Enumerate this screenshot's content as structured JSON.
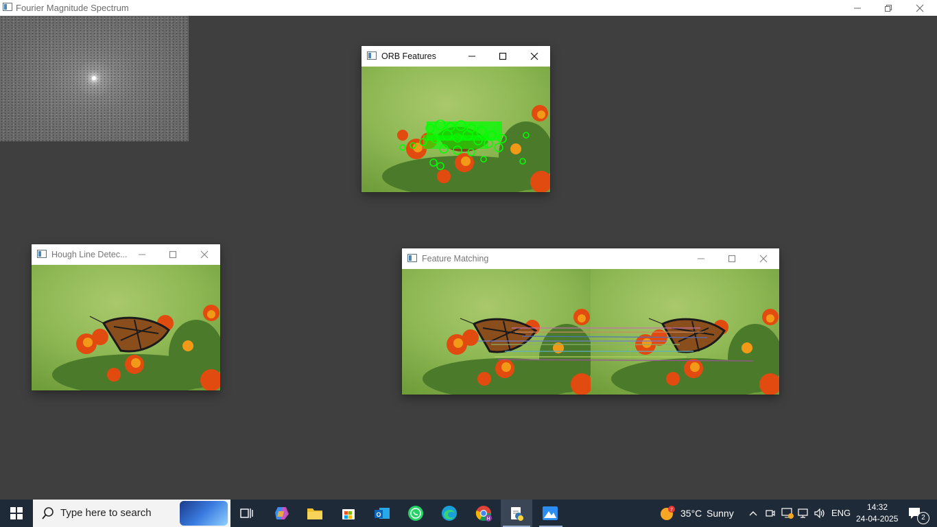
{
  "main_window": {
    "title": "Fourier Magnitude Spectrum",
    "icons": {
      "app": "opencv-window-icon",
      "minimize": "minimize-icon",
      "restore": "restore-icon",
      "close": "close-icon"
    }
  },
  "windows": {
    "orb": {
      "title": "ORB Features"
    },
    "hough": {
      "title": "Hough Line Detec..."
    },
    "matching": {
      "title": "Feature Matching"
    }
  },
  "taskbar": {
    "search_placeholder": "Type here to search",
    "apps": [
      "start-icon",
      "task-view-icon",
      "copilot-icon",
      "file-explorer-icon",
      "microsoft-store-icon",
      "outlook-icon",
      "whatsapp-icon",
      "edge-icon",
      "chrome-icon",
      "python-icon",
      "photos-icon"
    ],
    "weather": {
      "temp": "35°C",
      "condition": "Sunny",
      "badge": "7"
    },
    "language": "ENG",
    "time": "14:32",
    "date": "24-04-2025",
    "notification_count": "2"
  },
  "colors": {
    "desktop": "#3f3f3f",
    "taskbar": "#1f2a38",
    "orb_keypoints": "#00ff00"
  }
}
